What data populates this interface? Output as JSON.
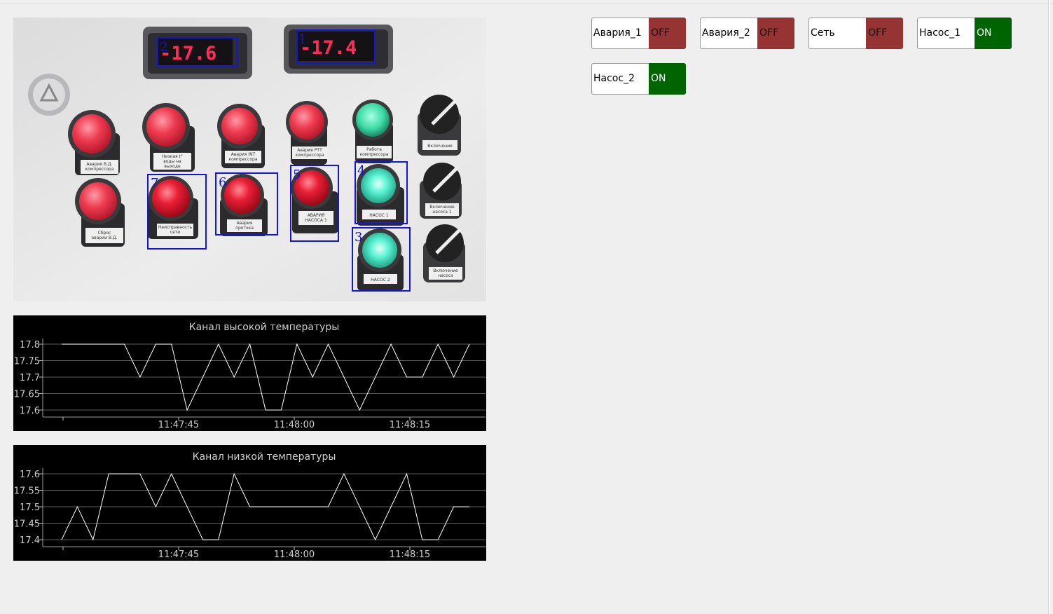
{
  "statuses": [
    {
      "label": "Авария_1",
      "value": "OFF",
      "state": "off"
    },
    {
      "label": "Авария_2",
      "value": "OFF",
      "state": "off"
    },
    {
      "label": "Сеть",
      "value": "OFF",
      "state": "off"
    },
    {
      "label": "Насос_1",
      "value": "ON",
      "state": "on"
    },
    {
      "label": "Насос_2",
      "value": "ON",
      "state": "on"
    }
  ],
  "colors": {
    "off": "#963434",
    "on": "#006400",
    "detection_box": "#1515d8",
    "display_digits": "#ff2d5a"
  },
  "camera": {
    "displays": [
      {
        "id": "2",
        "reading": "-17.6"
      },
      {
        "id": "1",
        "reading": "-17.4"
      }
    ],
    "detections": [
      {
        "id": "7",
        "plate": [
          "Неисправность",
          "сети"
        ],
        "color": "red"
      },
      {
        "id": "6",
        "plate": [
          "Авария",
          "протока"
        ],
        "color": "red"
      },
      {
        "id": "5",
        "plate": [
          "АВАРИЯ",
          "НАСОСА 1"
        ],
        "color": "red"
      },
      {
        "id": "4",
        "plate": [
          "НАСОС 1"
        ],
        "color": "green"
      },
      {
        "id": "3",
        "plate": [
          "НАСОС 2"
        ],
        "color": "green"
      }
    ],
    "other_plates": [
      [
        "Авария В.Д.",
        "компрессора"
      ],
      [
        "Низкая t°",
        "воды на",
        "выходе"
      ],
      [
        "Авария INT",
        "компрессора"
      ],
      [
        "Авария РТТ",
        "компрессора"
      ],
      [
        "Работа",
        "компрессора"
      ],
      [
        "Включение"
      ],
      [
        "Сброс",
        "аварии В.Д."
      ],
      [
        "Включение",
        "насоса 1"
      ],
      [
        "Включение",
        "насоса"
      ]
    ]
  },
  "chart_data": [
    {
      "type": "line",
      "title": "Канал высокой температуры",
      "x_ticks": [
        "11:47:45",
        "11:48:00",
        "11:48:15"
      ],
      "y_ticks": [
        "17.8",
        "17.75",
        "17.7",
        "17.65",
        "17.6"
      ],
      "ylim": [
        17.6,
        17.8
      ],
      "series": [
        {
          "values": [
            17.8,
            17.8,
            17.8,
            17.8,
            17.8,
            17.7,
            17.8,
            17.8,
            17.6,
            17.7,
            17.8,
            17.7,
            17.8,
            17.6,
            17.6,
            17.8,
            17.7,
            17.8,
            17.7,
            17.6,
            17.7,
            17.8,
            17.7,
            17.7,
            17.8,
            17.7,
            17.8
          ]
        }
      ]
    },
    {
      "type": "line",
      "title": "Канал низкой температуры",
      "x_ticks": [
        "11:47:45",
        "11:48:00",
        "11:48:15"
      ],
      "y_ticks": [
        "17.6",
        "17.55",
        "17.5",
        "17.45",
        "17.4"
      ],
      "ylim": [
        17.4,
        17.6
      ],
      "series": [
        {
          "values": [
            17.4,
            17.5,
            17.4,
            17.6,
            17.6,
            17.6,
            17.5,
            17.6,
            17.5,
            17.4,
            17.4,
            17.6,
            17.5,
            17.5,
            17.5,
            17.5,
            17.5,
            17.5,
            17.6,
            17.5,
            17.4,
            17.5,
            17.6,
            17.4,
            17.4,
            17.5,
            17.5
          ]
        }
      ]
    }
  ]
}
